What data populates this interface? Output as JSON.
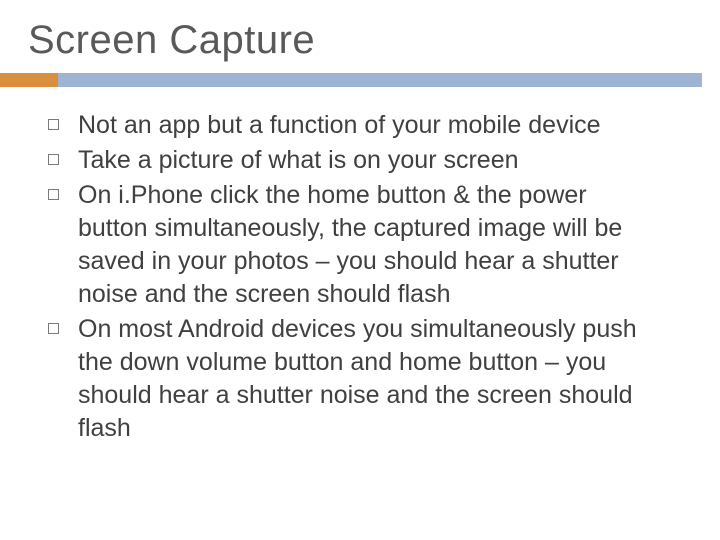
{
  "title": "Screen Capture",
  "bullets": [
    "Not an app but a function of your mobile device",
    "Take a picture of what is on your screen",
    "On i.Phone click the home button & the power button simultaneously, the captured image will be saved in your photos – you should hear a shutter noise and the screen should flash",
    "On most Android devices you simultaneously push the down volume button and home button – you should hear a shutter noise and the screen should flash"
  ],
  "colors": {
    "accent": "#d98f3d",
    "bar": "#9fb4d3"
  }
}
